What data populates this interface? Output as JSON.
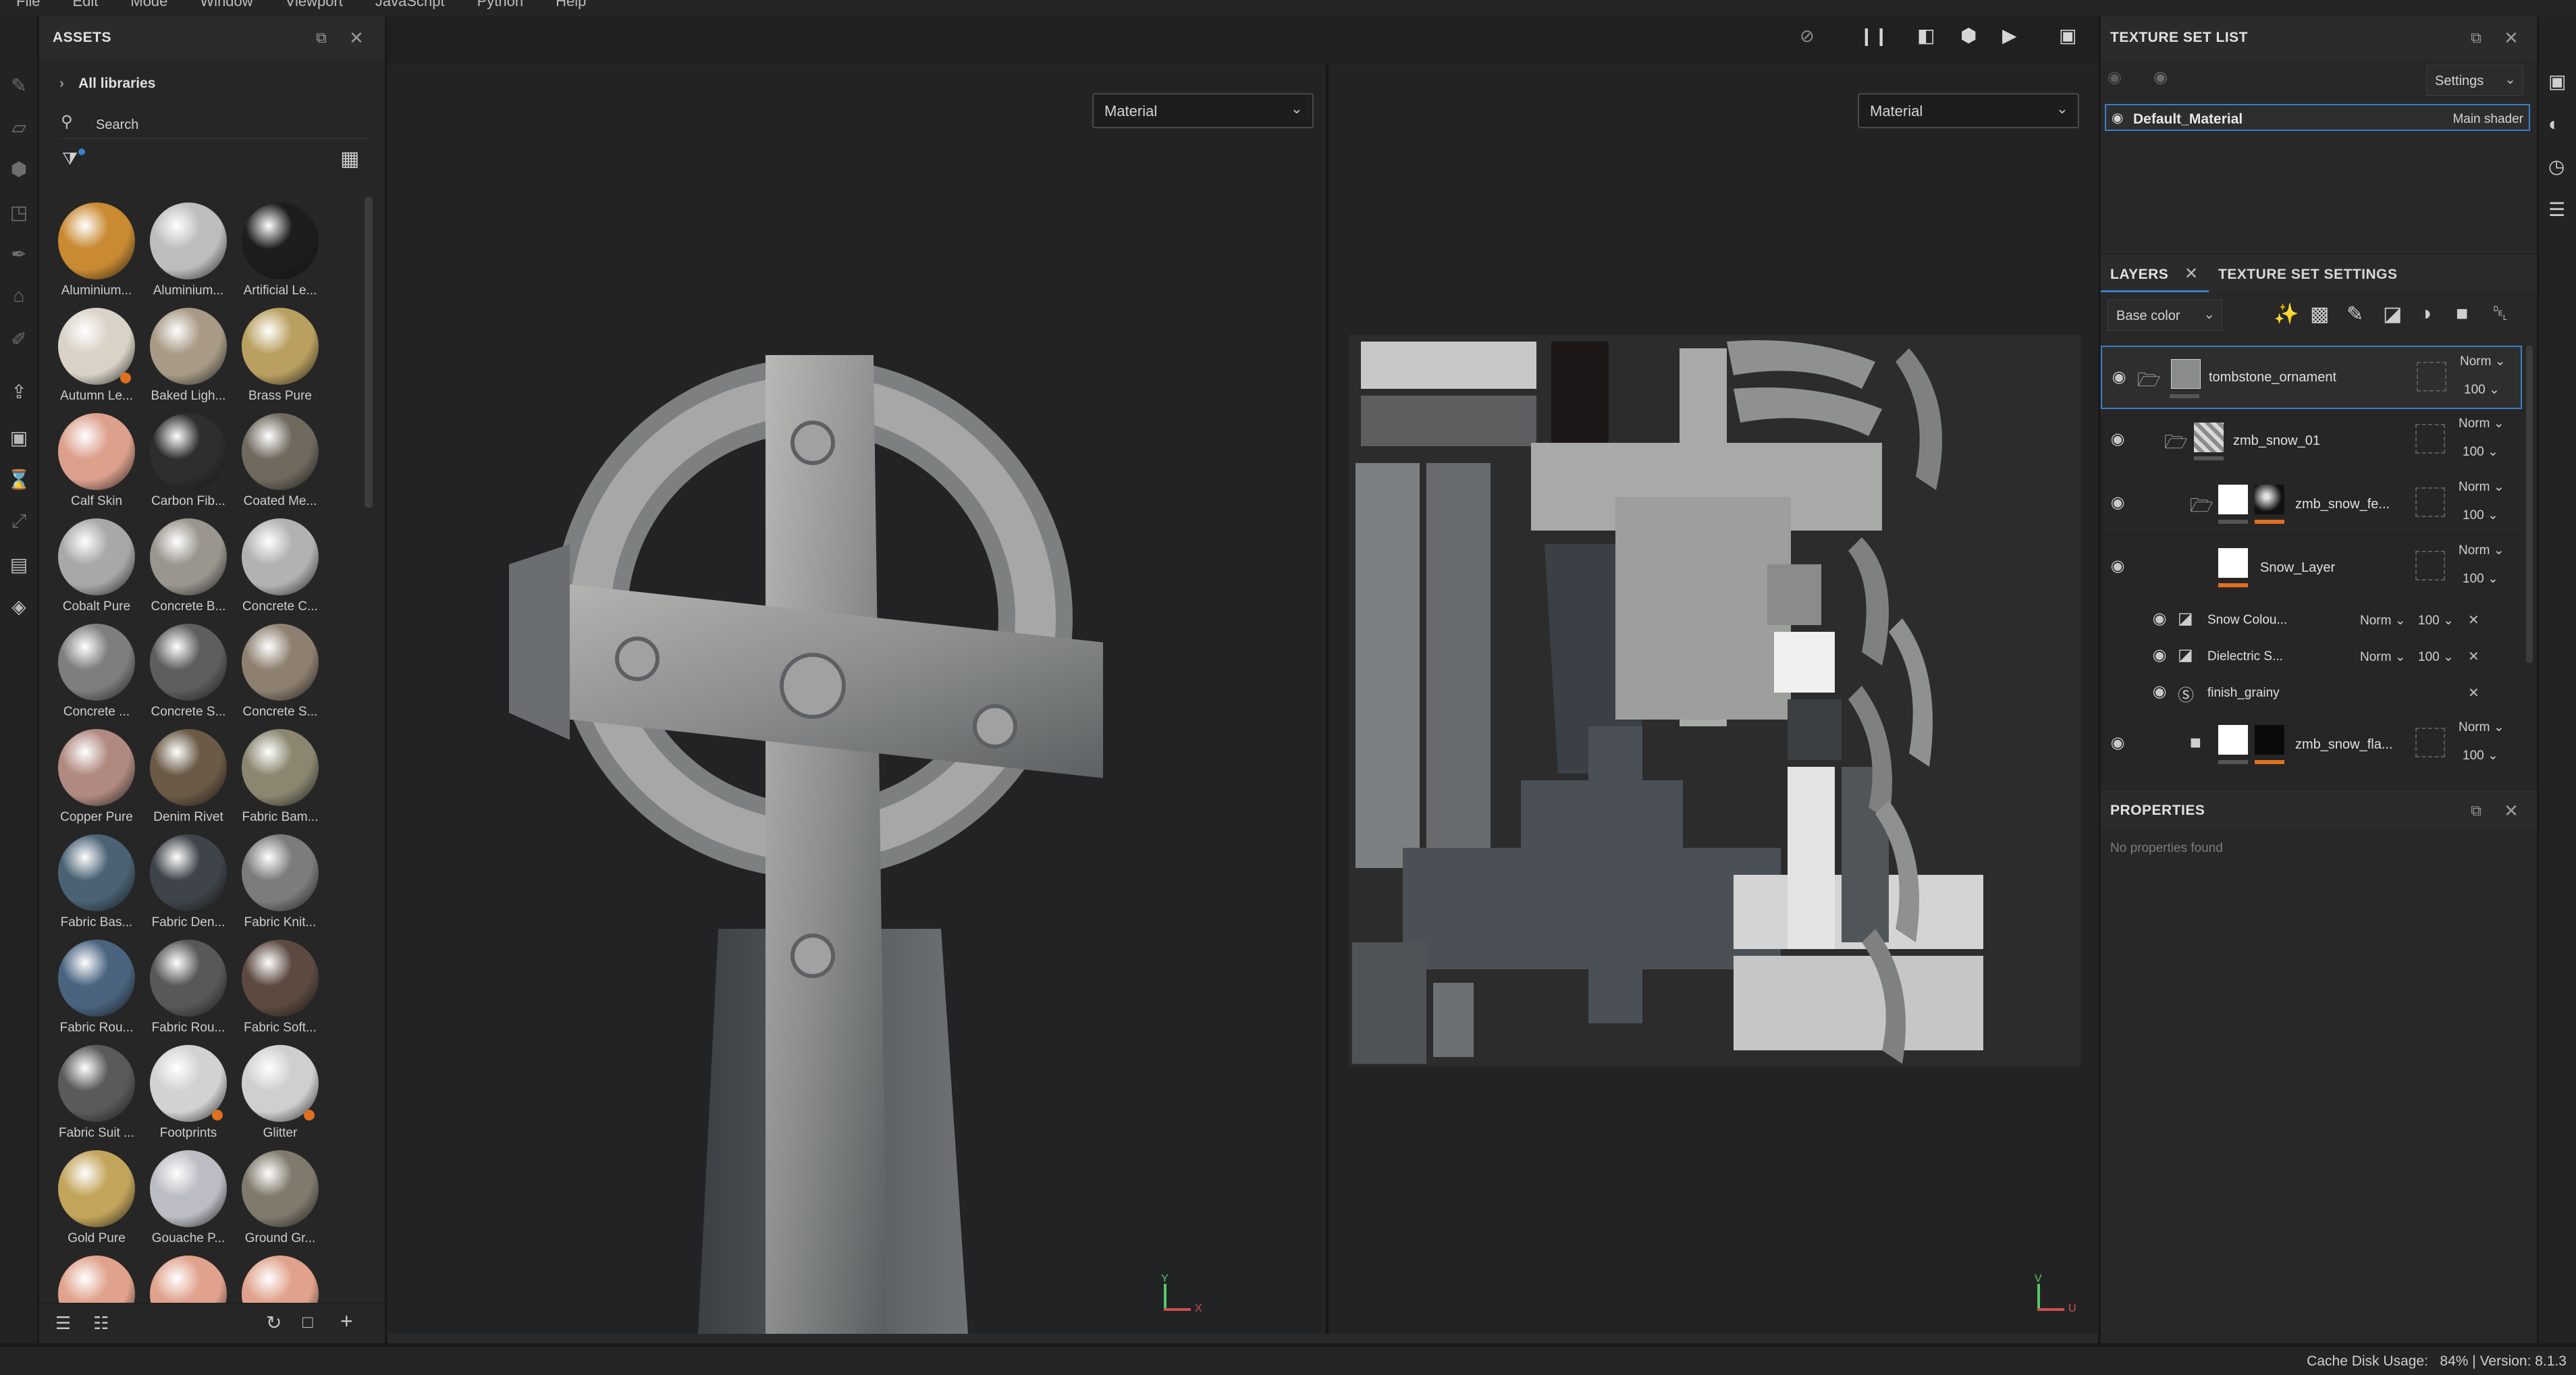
{
  "menubar": [
    "File",
    "Edit",
    "Mode",
    "Window",
    "Viewport",
    "JavaScript",
    "Python",
    "Help"
  ],
  "assets": {
    "title": "ASSETS",
    "all_libraries": "All libraries",
    "search_placeholder": "Search",
    "items": [
      {
        "name": "Aluminium...",
        "color": "#c98a32",
        "badge": "none"
      },
      {
        "name": "Aluminium...",
        "color": "#bdbdbd",
        "badge": "none"
      },
      {
        "name": "Artificial Le...",
        "color": "#1d1d1d",
        "badge": "none"
      },
      {
        "name": "Autumn Le...",
        "color": "#d9d2c6",
        "badge": "orange"
      },
      {
        "name": "Baked Ligh...",
        "color": "#a89a86",
        "badge": "none"
      },
      {
        "name": "Brass Pure",
        "color": "#b9a060",
        "badge": "none"
      },
      {
        "name": "Calf Skin",
        "color": "#dca08c",
        "badge": "none"
      },
      {
        "name": "Carbon Fib...",
        "color": "#2e2e2e",
        "badge": "none"
      },
      {
        "name": "Coated Me...",
        "color": "#706a5e",
        "badge": "none"
      },
      {
        "name": "Cobalt Pure",
        "color": "#a8a8a8",
        "badge": "none"
      },
      {
        "name": "Concrete B...",
        "color": "#9a968e",
        "badge": "none"
      },
      {
        "name": "Concrete C...",
        "color": "#b2b2b2",
        "badge": "none"
      },
      {
        "name": "Concrete ...",
        "color": "#7e7e7e",
        "badge": "none"
      },
      {
        "name": "Concrete S...",
        "color": "#5e5e5e",
        "badge": "none"
      },
      {
        "name": "Concrete S...",
        "color": "#8e8070",
        "badge": "none"
      },
      {
        "name": "Copper Pure",
        "color": "#b08a80",
        "badge": "none"
      },
      {
        "name": "Denim Rivet",
        "color": "#6a5a46",
        "badge": "none"
      },
      {
        "name": "Fabric Bam...",
        "color": "#8a8670",
        "badge": "none"
      },
      {
        "name": "Fabric Bas...",
        "color": "#4a6274",
        "badge": "none"
      },
      {
        "name": "Fabric Den...",
        "color": "#3e444a",
        "badge": "none"
      },
      {
        "name": "Fabric Knit...",
        "color": "#7c7c7c",
        "badge": "none"
      },
      {
        "name": "Fabric Rou...",
        "color": "#4a6480",
        "badge": "none"
      },
      {
        "name": "Fabric Rou...",
        "color": "#585858",
        "badge": "none"
      },
      {
        "name": "Fabric Soft...",
        "color": "#5c4a40",
        "badge": "none"
      },
      {
        "name": "Fabric Suit ...",
        "color": "#5a5a5a",
        "badge": "none"
      },
      {
        "name": "Footprints",
        "color": "#d2d2d2",
        "badge": "orange"
      },
      {
        "name": "Glitter",
        "color": "#cfcfcf",
        "badge": "orange"
      },
      {
        "name": "Gold Pure",
        "color": "#c2a45a",
        "badge": "none"
      },
      {
        "name": "Gouache P...",
        "color": "#bcbcc4",
        "badge": "none"
      },
      {
        "name": "Ground Gr...",
        "color": "#807a6c",
        "badge": "none"
      },
      {
        "name": "",
        "color": "#e0a28c",
        "badge": "none"
      },
      {
        "name": "",
        "color": "#e0a28c",
        "badge": "none"
      },
      {
        "name": "",
        "color": "#e0a28c",
        "badge": "none"
      }
    ]
  },
  "viewport": {
    "left_material": "Material",
    "right_material": "Material",
    "axis_y": "Y",
    "axis_x": "X",
    "axis_v": "V",
    "axis_u": "U"
  },
  "texture_set_list": {
    "title": "TEXTURE SET LIST",
    "settings_label": "Settings",
    "material_name": "Default_Material",
    "shader_name": "Main shader"
  },
  "layers": {
    "tab_layers": "LAYERS",
    "tab_settings": "TEXTURE SET SETTINGS",
    "channel": "Base color",
    "rows": [
      {
        "name": "tombstone_ornament",
        "blend": "Norm",
        "opacity": "100"
      },
      {
        "name": "zmb_snow_01",
        "blend": "Norm",
        "opacity": "100"
      },
      {
        "name": "zmb_snow_fe...",
        "blend": "Norm",
        "opacity": "100"
      },
      {
        "name": "Snow_Layer",
        "blend": "Norm",
        "opacity": "100"
      },
      {
        "name": "zmb_snow_fla...",
        "blend": "Norm",
        "opacity": "100"
      }
    ],
    "effects": [
      {
        "name": "Snow Colou...",
        "blend": "Norm",
        "opacity": "100"
      },
      {
        "name": "Dielectric S...",
        "blend": "Norm",
        "opacity": "100"
      },
      {
        "name": "finish_grainy",
        "blend": "",
        "opacity": ""
      }
    ]
  },
  "properties": {
    "title": "PROPERTIES",
    "empty_text": "No properties found"
  },
  "status": {
    "text": "Cache Disk Usage:   84% | Version: 8.1.3"
  },
  "colors": {
    "accent_blue": "#3b7fc8",
    "mask_orange": "#e07020"
  }
}
